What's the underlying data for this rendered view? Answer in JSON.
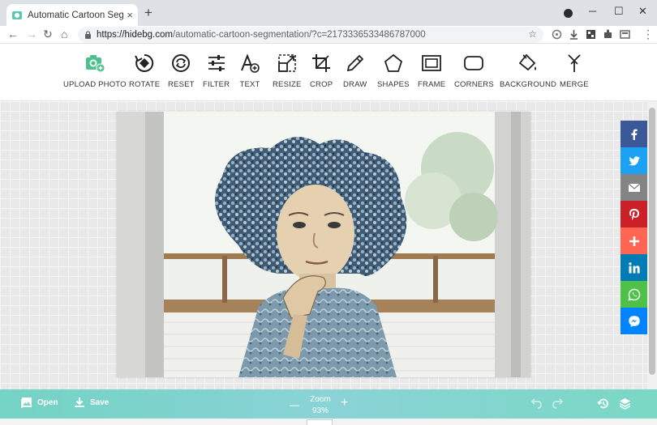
{
  "browser": {
    "tab_title": "Automatic Cartoon Segmentat",
    "tab_close": "×",
    "new_tab": "+",
    "url_host": "https://hidebg.com",
    "url_path": "/automatic-cartoon-segmentation/?c=2173336533486787000",
    "window_controls": {
      "minimize": "─",
      "maximize": "☐",
      "close": "✕"
    }
  },
  "toolbar": {
    "items": [
      {
        "label": "UPLOAD PHOTO",
        "icon": "camera-plus-icon"
      },
      {
        "label": "ROTATE",
        "icon": "rotate-icon"
      },
      {
        "label": "RESET",
        "icon": "reset-icon"
      },
      {
        "label": "FILTER",
        "icon": "filter-sliders-icon"
      },
      {
        "label": "TEXT",
        "icon": "text-icon"
      },
      {
        "label": "RESIZE",
        "icon": "resize-icon"
      },
      {
        "label": "CROP",
        "icon": "crop-icon"
      },
      {
        "label": "DRAW",
        "icon": "pencil-icon"
      },
      {
        "label": "SHAPES",
        "icon": "pentagon-icon"
      },
      {
        "label": "FRAME",
        "icon": "frame-icon"
      },
      {
        "label": "CORNERS",
        "icon": "rounded-rect-icon"
      },
      {
        "label": "BACKGROUND",
        "icon": "paint-bucket-icon"
      },
      {
        "label": "MERGE",
        "icon": "merge-icon"
      }
    ]
  },
  "share": [
    {
      "name": "facebook",
      "color": "#3b5998"
    },
    {
      "name": "twitter",
      "color": "#1da1f2"
    },
    {
      "name": "email",
      "color": "#848484"
    },
    {
      "name": "pinterest",
      "color": "#cb2027"
    },
    {
      "name": "more",
      "color": "#ff6550"
    },
    {
      "name": "linkedin",
      "color": "#007bb5"
    },
    {
      "name": "whatsapp",
      "color": "#4dc247"
    },
    {
      "name": "messenger",
      "color": "#0084ff"
    }
  ],
  "bottom": {
    "open_label": "Open",
    "save_label": "Save",
    "zoom_label": "Zoom",
    "zoom_value": "93%",
    "zoom_out": "—",
    "zoom_in": "+"
  },
  "colors": {
    "accent": "#79d5c7",
    "upload_icon": "#4fc08d"
  }
}
